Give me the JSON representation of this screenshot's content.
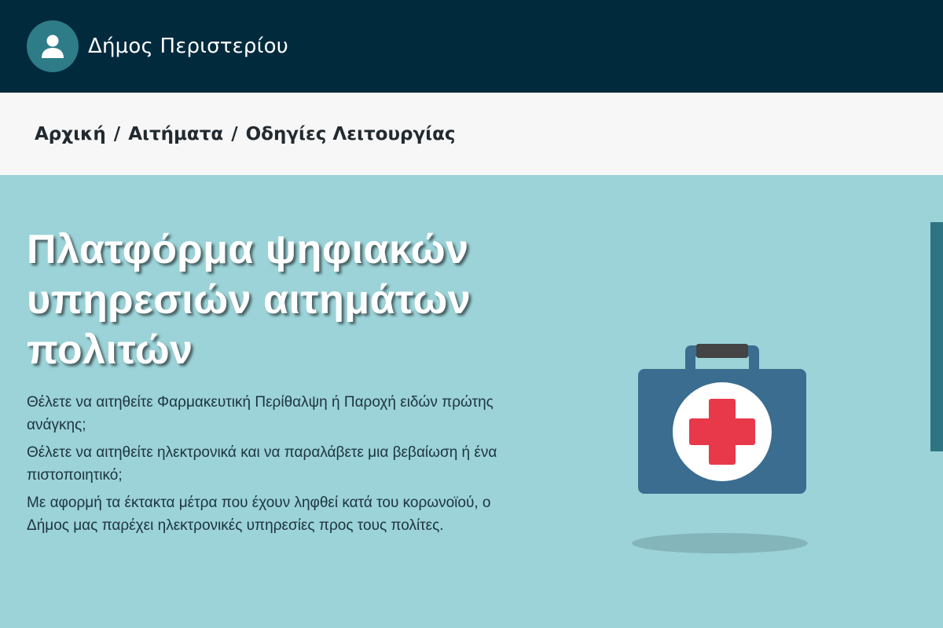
{
  "header": {
    "title": "Δήμος Περιστερίου",
    "avatar_icon": "user-icon"
  },
  "breadcrumb": {
    "items": [
      "Αρχική",
      "Αιτήματα",
      "Οδηγίες Λειτουργίας"
    ],
    "separator": "/"
  },
  "hero": {
    "title": "Πλατφόρμα ψηφιακών υπηρεσιών αιτημάτων πολιτών",
    "paragraphs": [
      "Θέλετε να αιτηθείτε Φαρμακευτική Περίθαλψη ή Παροχή ειδών πρώτης ανάγκης;",
      "Θέλετε να αιτηθείτε ηλεκτρονικά και να παραλάβετε μια βεβαίωση ή ένα πιστοποιητικό;",
      "Με αφορμή τα έκτακτα μέτρα που έχουν ληφθεί κατά του κορωνοϊού, ο Δήμος μας παρέχει ηλεκτρονικές υπηρεσίες προς τους πολίτες."
    ],
    "illustration_icon": "first-aid-kit-icon"
  },
  "colors": {
    "header_bg": "#022a3d",
    "breadcrumb_bg": "#f7f7f7",
    "hero_bg": "#9bd3d8",
    "avatar_bg": "#2e7c88",
    "kit_body": "#3a6d8f",
    "kit_cross": "#e8394b"
  }
}
